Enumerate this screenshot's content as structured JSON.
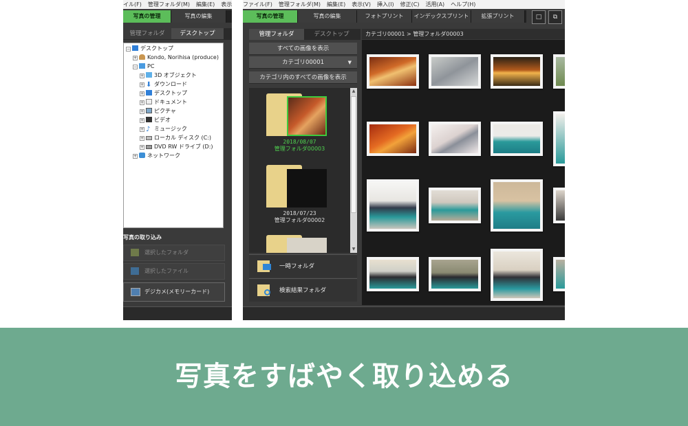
{
  "left": {
    "menu": [
      "イル(F)",
      "管理フォルダ(M)",
      "編集(E)",
      "表示"
    ],
    "tabs": [
      "写真の管理",
      "写真の編集"
    ],
    "subtabs": [
      "管理フォルダ",
      "デスクトップ"
    ],
    "tree": [
      "デスクトップ",
      "Kondo, Norihisa (produce)",
      "PC",
      "3D オブジェクト",
      "ダウンロード",
      "デスクトップ",
      "ドキュメント",
      "ピクチャ",
      "ビデオ",
      "ミュージック",
      "ローカル ディスク (C:)",
      "DVD RW ドライブ (D:)",
      "ネットワーク"
    ],
    "import_title": "写真の取り込み",
    "import_items": [
      "選択したフォルダ",
      "選択したファイル",
      "デジカメ(メモリーカード)"
    ]
  },
  "right": {
    "menu": [
      "ファイル(F)",
      "管理フォルダ(M)",
      "編集(E)",
      "表示(V)",
      "挿入(I)",
      "修正(C)",
      "活用(A)",
      "ヘルプ(H)"
    ],
    "tabs": [
      "写真の管理",
      "写真の編集",
      "フォトプリント",
      "インデックスプリント",
      "拡張プリント"
    ],
    "subtabs": [
      "管理フォルダ",
      "デスクトップ"
    ],
    "breadcrumb": "カテゴリ00001 > 管理フォルダ00003",
    "show_all": "すべての画像を表示",
    "category_select": "カテゴリ00001",
    "show_category_all": "カテゴリ内のすべての画像を表示",
    "folders": [
      {
        "date": "2018/08/07",
        "name": "管理フォルダ00003"
      },
      {
        "date": "2018/07/23",
        "name": "管理フォルダ00002"
      }
    ],
    "special": [
      "一時フォルダ",
      "検索結果フォルダ"
    ]
  },
  "banner": "写真をすばやく取り込める"
}
